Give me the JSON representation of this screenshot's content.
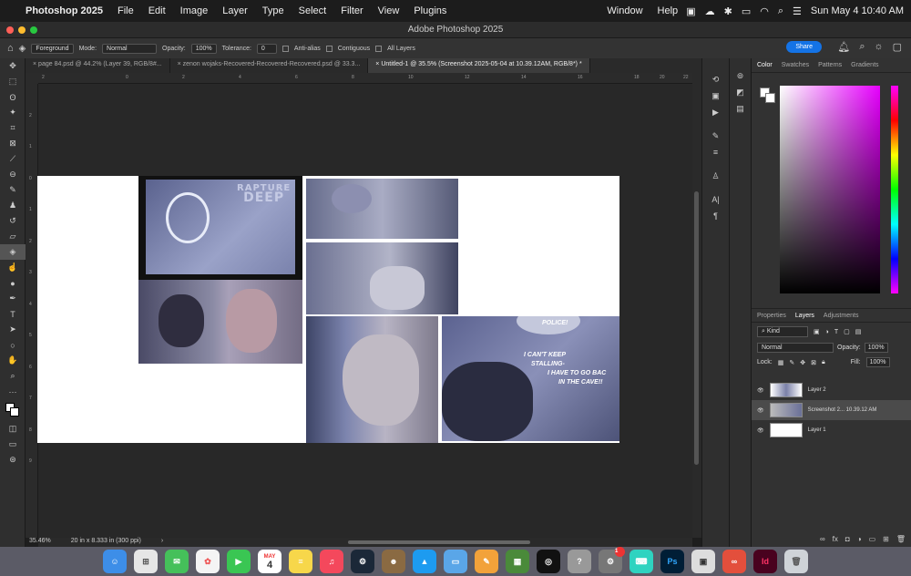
{
  "menubar": {
    "app_name": "Photoshop 2025",
    "items": [
      "File",
      "Edit",
      "Image",
      "Layer",
      "Type",
      "Select",
      "Filter",
      "View",
      "Plugins"
    ],
    "right_items": [
      "Window",
      "Help"
    ],
    "datetime": "Sun May 4  10:40 AM"
  },
  "window": {
    "title": "Adobe Photoshop 2025"
  },
  "options": {
    "preset": "Foreground",
    "mode_label": "Mode:",
    "mode_value": "Normal",
    "opacity_label": "Opacity:",
    "opacity_value": "100%",
    "tolerance_label": "Tolerance:",
    "tolerance_value": "0",
    "antialias": "Anti-alias",
    "contiguous": "Contiguous",
    "all_layers": "All Layers",
    "share": "Share"
  },
  "tabs": [
    {
      "label": "page 84.psd @ 44.2% (Layer 39, RGB/8#..."
    },
    {
      "label": "zenon wojaks-Recovered-Recovered-Recovered.psd @ 33.3..."
    },
    {
      "label": "Untitled-1 @ 35.5% (Screenshot 2025-05-04 at 10.39.12AM, RGB/8*) *"
    }
  ],
  "rulers": {
    "h": [
      "2",
      "0",
      "2",
      "4",
      "6",
      "8",
      "10",
      "12",
      "14",
      "16",
      "18",
      "20",
      "22"
    ],
    "v": [
      "2",
      "1",
      "0",
      "1",
      "2",
      "3",
      "4",
      "5",
      "6",
      "7",
      "8",
      "9"
    ]
  },
  "canvas_text": {
    "sign1": "RAPTURE",
    "sign2": "DEEP",
    "bubble_police": "POLICE!",
    "speech1": "I CAN'T KEEP",
    "speech2": "STALLING-",
    "speech3": "I HAVE TO GO BAC",
    "speech4": "IN THE CAVE!!"
  },
  "status": {
    "zoom": "35.46%",
    "doc_size": "20 in x 8.333 in (300 ppi)"
  },
  "color_panel": {
    "tabs": [
      "Color",
      "Swatches",
      "Patterns",
      "Gradients"
    ]
  },
  "layers_panel": {
    "tabs": [
      "Properties",
      "Layers",
      "Adjustments"
    ],
    "filter": "Kind",
    "blend": "Normal",
    "opacity_label": "Opacity:",
    "opacity": "100%",
    "lock_label": "Lock:",
    "fill_label": "Fill:",
    "fill": "100%",
    "layers": [
      {
        "name": "Layer 2"
      },
      {
        "name": "Screenshot 2... 10.39.12 AM"
      },
      {
        "name": "Layer 1"
      }
    ]
  },
  "dock": {
    "calendar_month": "MAY",
    "calendar_day": "4",
    "badge": "1",
    "ps_label": "Ps",
    "id_label": "Id"
  },
  "colors": {
    "accent": "#1473e6",
    "panel": "#323232",
    "art_tint": "#7a80a8"
  }
}
